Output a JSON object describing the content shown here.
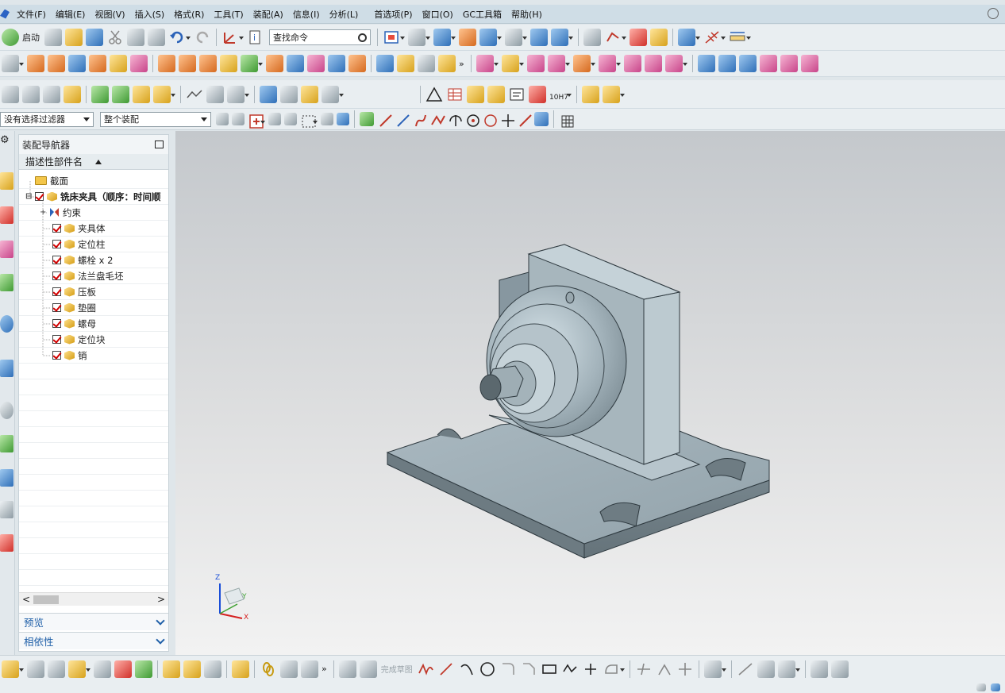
{
  "menu": {
    "items": [
      "文件(F)",
      "编辑(E)",
      "视图(V)",
      "插入(S)",
      "格式(R)",
      "工具(T)",
      "装配(A)",
      "信息(I)",
      "分析(L)",
      "首选项(P)",
      "窗口(O)",
      "GC工具箱",
      "帮助(H)"
    ]
  },
  "toolbar": {
    "start_label": "启动",
    "search_placeholder": "查找命令",
    "more_glyph": "»",
    "tolerance_label": "10H7"
  },
  "filters": {
    "selection_filter": "没有选择过滤器",
    "scope": "整个装配"
  },
  "navigator": {
    "title": "装配导航器",
    "column_header": "描述性部件名",
    "section_item": "截面",
    "root_item": "铣床夹具（顺序：时间顺",
    "constraints_item": "约束",
    "parts": [
      "夹具体",
      "定位柱",
      "螺栓 x 2",
      "法兰盘毛坯",
      "压板",
      "垫圈",
      "螺母",
      "定位块",
      "销"
    ],
    "scroll_left": "<",
    "scroll_right": ">",
    "preview_label": "预览",
    "dependency_label": "相依性"
  },
  "triad": {
    "z_label": "Z",
    "y_label": "Y",
    "x_label": "X"
  },
  "bottom_toolbar": {
    "finish_sketch_label": "完成草图"
  },
  "colors": {
    "menubar_bg": "#cfdde6",
    "toolbar_bg": "#e9eef1",
    "part_steel": "#8a9aa2",
    "accent_blue": "#1f5fa8",
    "check_red": "#d20000"
  }
}
